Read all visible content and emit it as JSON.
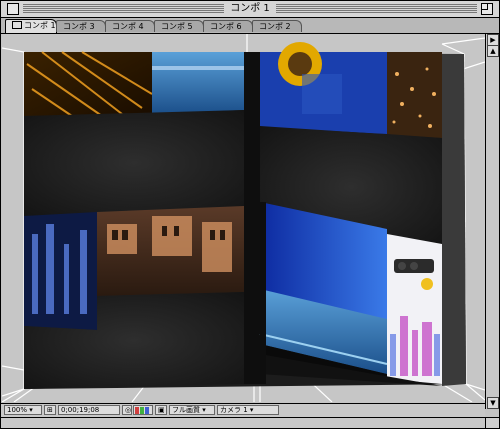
{
  "window": {
    "title": "コンポ 1"
  },
  "tabs": [
    {
      "label": "コンポ 1",
      "active": true
    },
    {
      "label": "コンポ 3",
      "active": false
    },
    {
      "label": "コンポ 4",
      "active": false
    },
    {
      "label": "コンポ 5",
      "active": false
    },
    {
      "label": "コンポ 6",
      "active": false
    },
    {
      "label": "コンポ 2",
      "active": false
    }
  ],
  "bottom_bar": {
    "zoom": "100%",
    "timecode": "0;00;19;08",
    "resolution": "フル画質",
    "camera": "カメラ 1"
  },
  "colors": {
    "window_gray": "#c4c4c4",
    "panel_dark": "#1e1e1e",
    "sky_blue": "#1f4fc8",
    "wireframe": "#ffffff"
  }
}
